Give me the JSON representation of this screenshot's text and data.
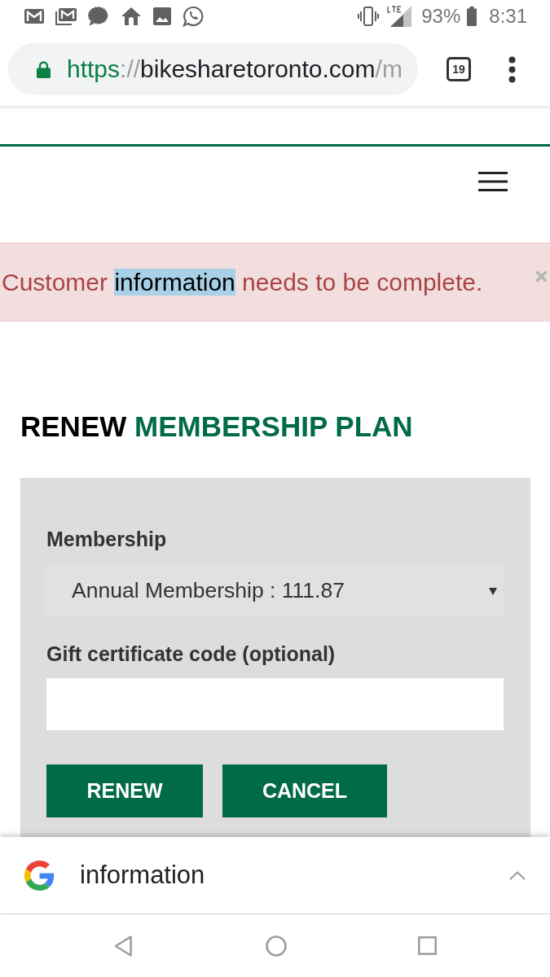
{
  "status_bar": {
    "battery": "93%",
    "time": "8:31"
  },
  "browser": {
    "address_bar": {
      "secure": true,
      "scheme": "https",
      "separator": "://",
      "host": "bikesharetoronto.com",
      "path": "/m"
    },
    "tab_count": "19"
  },
  "alert": {
    "message_parts": [
      {
        "text": "Customer ",
        "selected": false
      },
      {
        "text": "information",
        "selected": true
      },
      {
        "text": " needs to be complete.",
        "selected": false
      }
    ]
  },
  "heading": {
    "lead": "RENEW",
    "accent": "MEMBERSHIP PLAN"
  },
  "form": {
    "fields": [
      {
        "kind": "select",
        "label": "Membership",
        "value": "Annual Membership : 111.87"
      },
      {
        "kind": "text",
        "label": "Gift certificate code (optional)"
      }
    ],
    "buttons": [
      "RENEW",
      "CANCEL"
    ]
  },
  "search_bar": {
    "query": "information"
  }
}
